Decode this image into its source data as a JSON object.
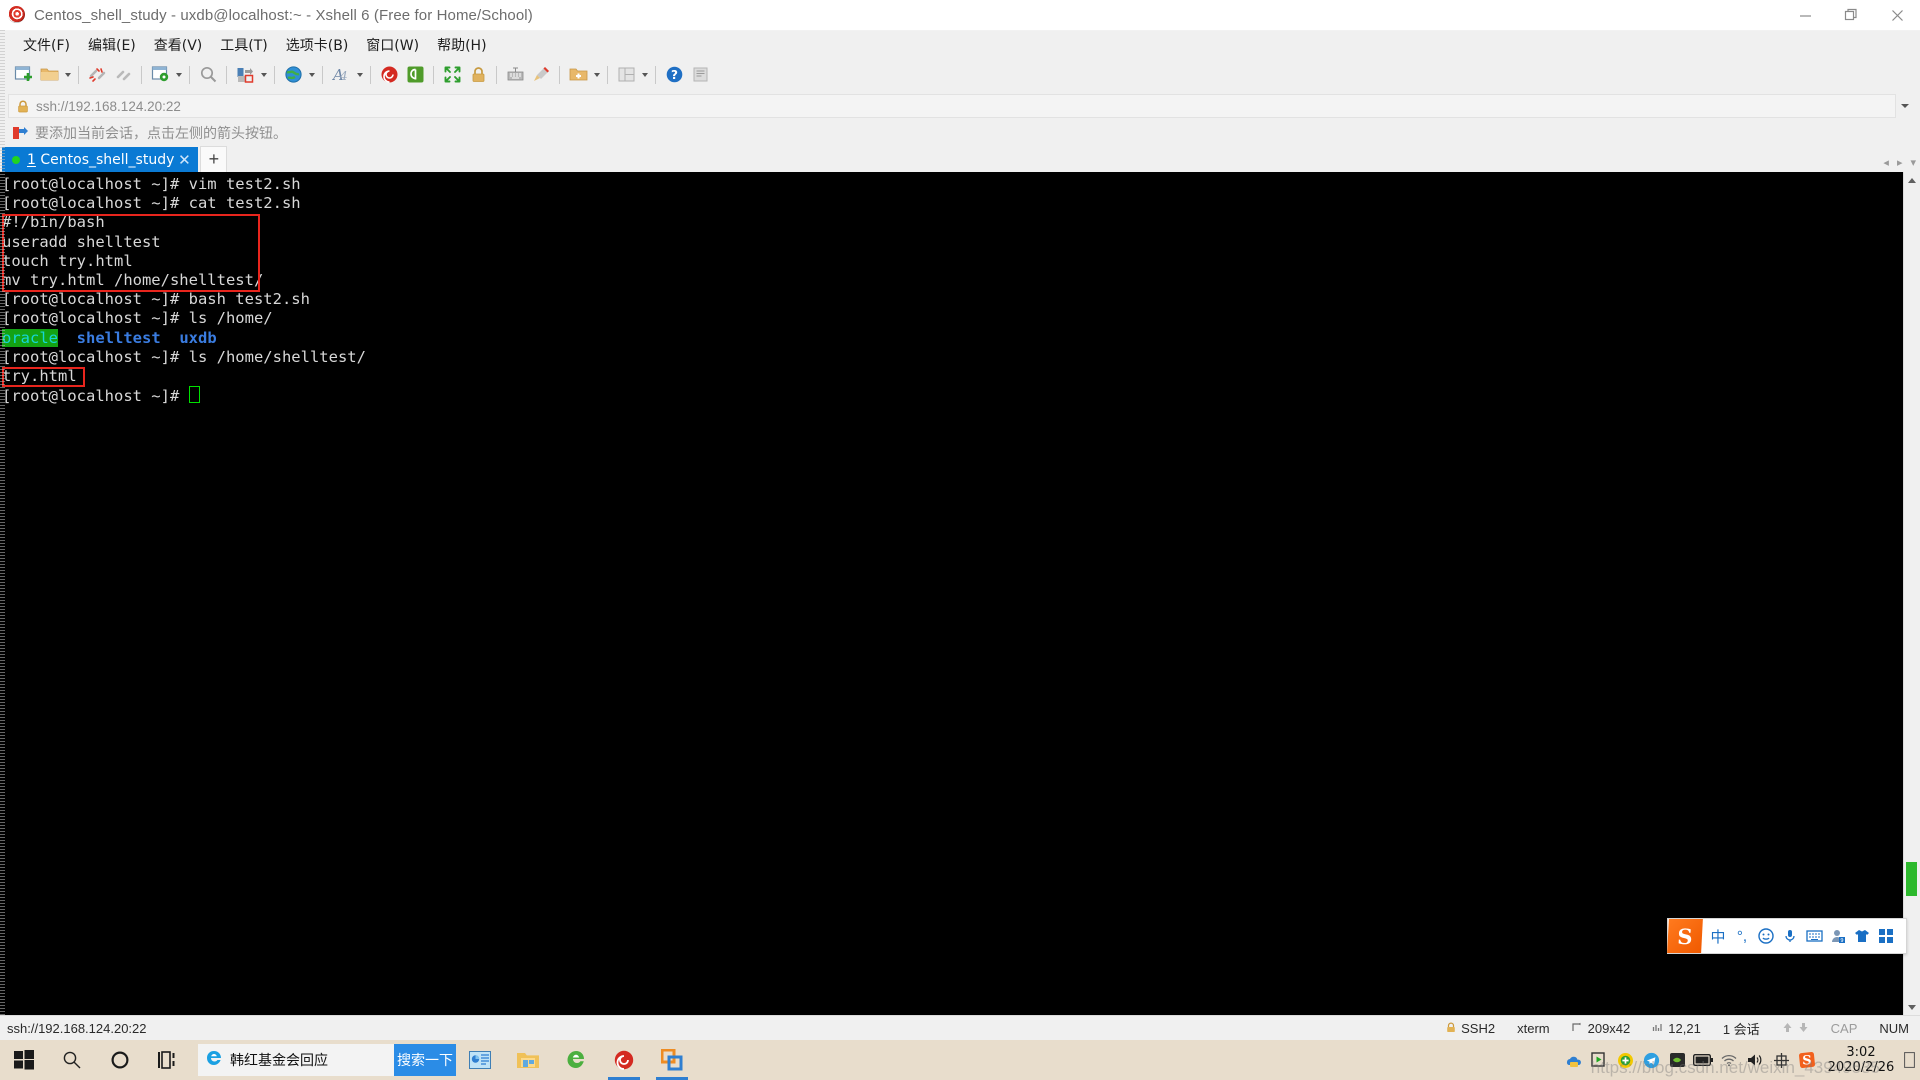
{
  "window": {
    "title": "Centos_shell_study - uxdb@localhost:~ - Xshell 6 (Free for Home/School)",
    "app_icon": "xshell-spiral-icon",
    "minimize_label": "—",
    "maximize_label": "❐",
    "close_label": "✕"
  },
  "menubar": {
    "items": [
      {
        "label": "文件(F)",
        "name": "menu-file"
      },
      {
        "label": "编辑(E)",
        "name": "menu-edit"
      },
      {
        "label": "查看(V)",
        "name": "menu-view"
      },
      {
        "label": "工具(T)",
        "name": "menu-tools"
      },
      {
        "label": "选项卡(B)",
        "name": "menu-tabs"
      },
      {
        "label": "窗口(W)",
        "name": "menu-window"
      },
      {
        "label": "帮助(H)",
        "name": "menu-help"
      }
    ]
  },
  "toolbar": {
    "icons": [
      "new-session-icon",
      "open-folder-icon",
      "disconnect-icon",
      "connect-icon",
      "session-manager-icon",
      "find-icon",
      "transfer-icon",
      "globe-icon",
      "font-icon",
      "xshell-icon",
      "xftp-icon",
      "fullscreen-icon",
      "lock-icon",
      "keyboard-icon",
      "highlight-icon",
      "add-folder-icon",
      "layout-icon",
      "help-icon",
      "note-icon"
    ]
  },
  "address_bar": {
    "value": "ssh://192.168.124.20:22",
    "lock_icon": "lock-icon",
    "dropdown_icon": "chevron-down-icon"
  },
  "hint_bar": {
    "icon": "arrow-flag-icon",
    "text": "要添加当前会话，点击左侧的箭头按钮。"
  },
  "tabs": {
    "active": {
      "index": "1",
      "label": "Centos_shell_study",
      "status_dot_color": "#21d421",
      "close_label": "✕"
    },
    "new_tab_label": "+",
    "nav_prev": "◂",
    "nav_next": "▸",
    "nav_menu": "▾"
  },
  "terminal": {
    "background": "#000000",
    "foreground": "#d8d8d8",
    "lines": [
      {
        "type": "plain",
        "text": "[root@localhost ~]# vim test2.sh"
      },
      {
        "type": "plain",
        "text": "[root@localhost ~]# cat test2.sh"
      },
      {
        "type": "plain",
        "text": "#!/bin/bash"
      },
      {
        "type": "plain",
        "text": "useradd shelltest"
      },
      {
        "type": "plain",
        "text": "touch try.html"
      },
      {
        "type": "plain",
        "text": "mv try.html /home/shelltest/"
      },
      {
        "type": "plain",
        "text": "[root@localhost ~]# bash test2.sh"
      },
      {
        "type": "plain",
        "text": "[root@localhost ~]# ls /home/"
      },
      {
        "type": "ls-colors",
        "parts": [
          {
            "text": "oracle",
            "style": "c-cyan-on-green"
          },
          {
            "text": "  ",
            "style": "plain"
          },
          {
            "text": "shelltest",
            "style": "c-blue"
          },
          {
            "text": "  ",
            "style": "plain"
          },
          {
            "text": "uxdb",
            "style": "c-blue"
          }
        ]
      },
      {
        "type": "plain",
        "text": "[root@localhost ~]# ls /home/shelltest/"
      },
      {
        "type": "plain",
        "text": "try.html"
      },
      {
        "type": "cursor",
        "text": "[root@localhost ~]# "
      }
    ],
    "annotations": [
      {
        "name": "script-body-highlight",
        "color": "#e8251d"
      },
      {
        "name": "result-file-highlight",
        "color": "#e8251d"
      }
    ],
    "cursor_color": "#00e000"
  },
  "ime": {
    "logo": "S",
    "items": [
      {
        "icon": "chinese-mode-icon",
        "glyph": "中"
      },
      {
        "icon": "punctuation-icon",
        "glyph": "°,"
      },
      {
        "icon": "emoji-icon",
        "glyph": "☺"
      },
      {
        "icon": "voice-input-icon",
        "glyph": "ᵕ"
      },
      {
        "icon": "soft-keyboard-icon",
        "glyph": "⌨"
      },
      {
        "icon": "user-icon",
        "glyph": "⚬"
      },
      {
        "icon": "skin-icon",
        "glyph": "▲"
      },
      {
        "icon": "toolbox-icon",
        "glyph": "▦"
      }
    ]
  },
  "statusbar": {
    "connection": "ssh://192.168.124.20:22",
    "protocol": "SSH2",
    "terminal_type": "xterm",
    "size": "209x42",
    "cursor_pos": "12,21",
    "sessions": "1 会话",
    "cap": "CAP",
    "num": "NUM",
    "lock_icon": "lock-icon",
    "size_icon": "resize-icon",
    "pos_icon": "cursor-pos-icon",
    "up_icon": "arrow-up-icon",
    "down_icon": "arrow-down-icon"
  },
  "taskbar": {
    "start_label": "start-icon",
    "search_label": "search-icon",
    "cortana_label": "cortana-icon",
    "taskview_label": "task-view-icon",
    "news": {
      "icon": "ie-icon",
      "text": "韩红基金会回应",
      "search_button": "搜索一下"
    },
    "apps": [
      {
        "name": "powerpoint-icon",
        "active": false
      },
      {
        "name": "file-explorer-icon",
        "active": false
      },
      {
        "name": "edge-icon",
        "active": false
      },
      {
        "name": "xshell-taskbar-icon",
        "active": true
      },
      {
        "name": "vmware-icon",
        "active": true
      }
    ],
    "tray": [
      {
        "name": "onedrive-icon"
      },
      {
        "name": "screen-recorder-icon"
      },
      {
        "name": "update-icon"
      },
      {
        "name": "telegram-icon"
      },
      {
        "name": "nvidia-icon"
      },
      {
        "name": "battery-icon"
      },
      {
        "name": "wifi-icon"
      },
      {
        "name": "volume-icon"
      },
      {
        "name": "ime-indicator-icon"
      },
      {
        "name": "sogou-tray-icon"
      }
    ],
    "clock": {
      "time": "3:02",
      "date": "2020/2/26"
    },
    "show_desktop": "show-desktop-button"
  },
  "watermark": "https://blog.csdn.net/weixin_43949535"
}
